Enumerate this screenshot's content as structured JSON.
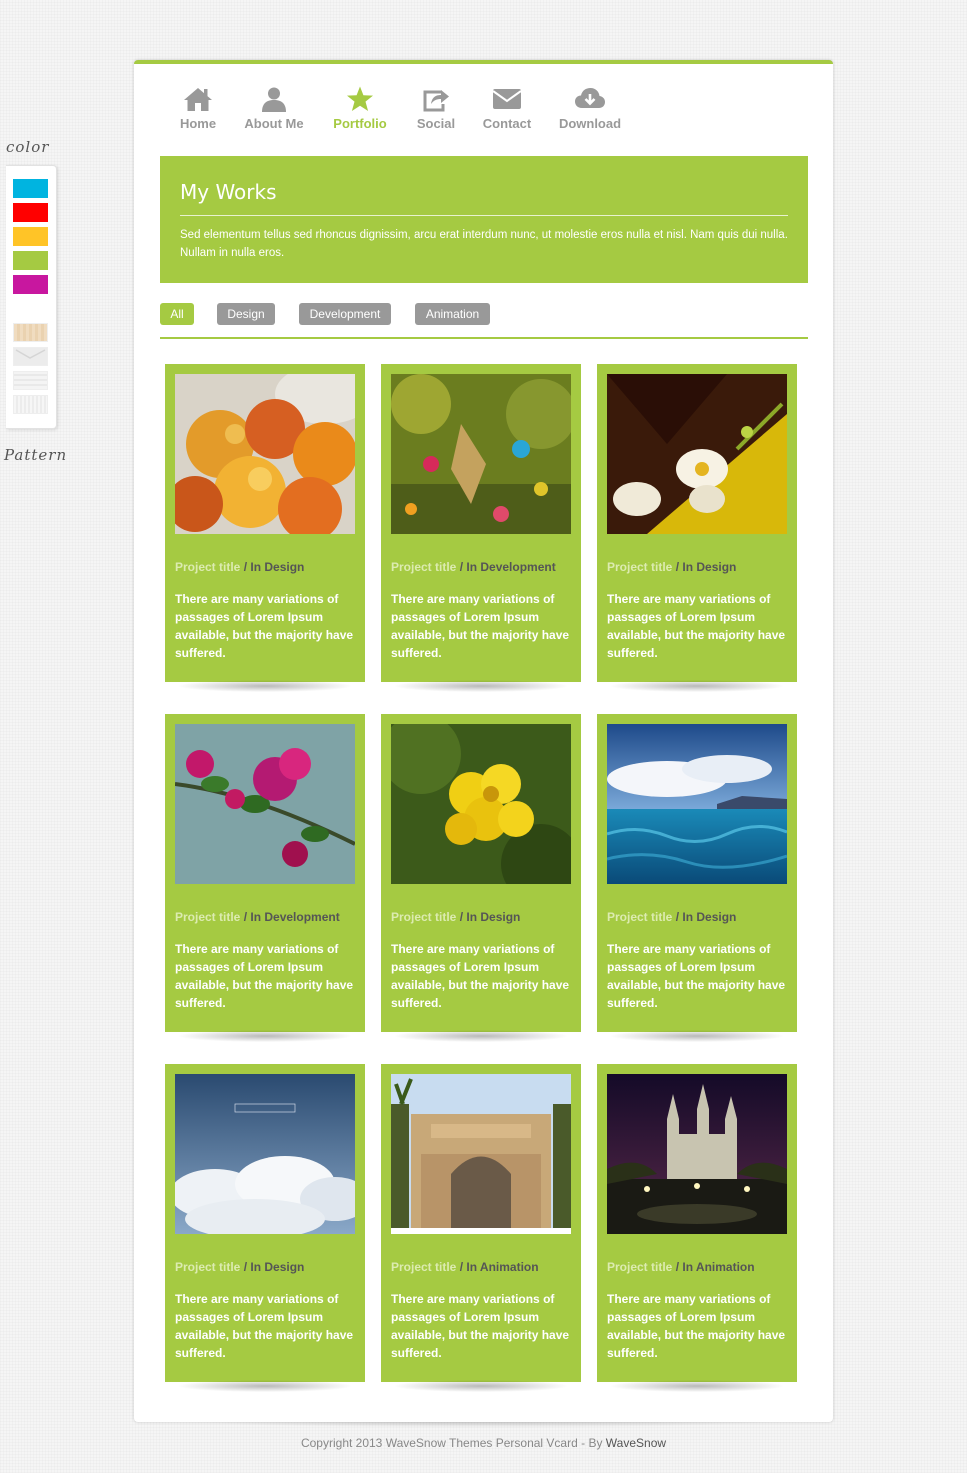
{
  "switcher": {
    "color_label": "color",
    "pattern_label": "Pattern",
    "colors": [
      "#00b4e0",
      "#ff0000",
      "#ffc427",
      "#a5ca42",
      "#c8179f"
    ],
    "patterns": [
      "wood",
      "envelope",
      "waves",
      "stripes"
    ]
  },
  "nav": {
    "items": [
      {
        "label": "Home",
        "icon": "home-icon"
      },
      {
        "label": "About Me",
        "icon": "user-icon"
      },
      {
        "label": "Portfolio",
        "icon": "star-icon"
      },
      {
        "label": "Social",
        "icon": "share-icon"
      },
      {
        "label": "Contact",
        "icon": "envelope-icon"
      },
      {
        "label": "Download",
        "icon": "cloud-download-icon"
      }
    ],
    "active": "Portfolio"
  },
  "works": {
    "title": "My Works",
    "text": "Sed elementum tellus sed rhoncus dignissim, arcu erat interdum nunc, ut molestie eros nulla et nisl. Nam quis dui nulla. Nullam in nulla eros."
  },
  "filters": [
    "All",
    "Design",
    "Development",
    "Animation"
  ],
  "projects": [
    {
      "title": "Project title",
      "category": " / In Design",
      "desc": "There are many variations of passages of Lorem Ipsum available, but the majority have suffered.",
      "image": "peaches"
    },
    {
      "title": "Project title",
      "category": " / In Development",
      "desc": "There are many variations of passages of Lorem Ipsum available, but the majority have suffered.",
      "image": "garden butterfly"
    },
    {
      "title": "Project title",
      "category": " / In Design",
      "desc": "There are many variations of passages of Lorem Ipsum available, but the majority have suffered.",
      "image": "white orchid"
    },
    {
      "title": "Project title",
      "category": " / In Development",
      "desc": "There are many variations of passages of Lorem Ipsum available, but the majority have suffered.",
      "image": "bougainvillea"
    },
    {
      "title": "Project title",
      "category": " / In Design",
      "desc": "There are many variations of passages of Lorem Ipsum available, but the majority have suffered.",
      "image": "yellow flowers"
    },
    {
      "title": "Project title",
      "category": " / In Design",
      "desc": "There are many variations of passages of Lorem Ipsum available, but the majority have suffered.",
      "image": "sea and clouds"
    },
    {
      "title": "Project title",
      "category": " / In Design",
      "desc": "There are many variations of passages of Lorem Ipsum available, but the majority have suffered.",
      "image": "stratocumulus"
    },
    {
      "title": "Project title",
      "category": " / In Animation",
      "desc": "There are many variations of passages of Lorem Ipsum available, but the majority have suffered.",
      "image": "studio gate"
    },
    {
      "title": "Project title",
      "category": " / In Animation",
      "desc": "There are many variations of passages of Lorem Ipsum available, but the majority have suffered.",
      "image": "cathedral at night"
    }
  ],
  "footer": {
    "text": "Copyright 2013 WaveSnow Themes Personal Vcard - By ",
    "brand": "WaveSnow"
  },
  "colors": {
    "accent": "#a5ca42",
    "muted": "#999999"
  }
}
